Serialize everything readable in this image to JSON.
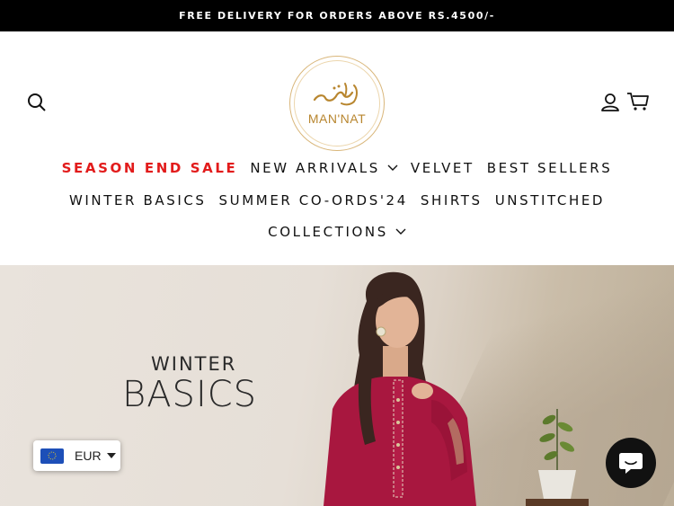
{
  "announcement": {
    "text": "FREE DELIVERY FOR ORDERS ABOVE RS.4500/-"
  },
  "header": {
    "logo_text": "MAN'NAT",
    "icons": {
      "search": "search-icon",
      "account": "user-icon",
      "cart": "cart-icon"
    }
  },
  "nav": {
    "row1": [
      {
        "label": "SEASON END SALE",
        "highlight": true
      },
      {
        "label": "NEW ARRIVALS",
        "dropdown": true
      },
      {
        "label": "VELVET"
      },
      {
        "label": "BEST SELLERS"
      }
    ],
    "row2": [
      {
        "label": "WINTER BASICS"
      },
      {
        "label": "SUMMER CO-ORDS'24"
      },
      {
        "label": "SHIRTS"
      },
      {
        "label": "UNSTITCHED"
      }
    ],
    "row3": [
      {
        "label": "COLLECTIONS",
        "dropdown": true
      }
    ]
  },
  "hero": {
    "line1": "WINTER",
    "line2": "BASICS"
  },
  "currency": {
    "code": "EUR",
    "flag": "eu-flag-icon"
  },
  "chat": {
    "icon": "chat-icon"
  },
  "colors": {
    "sale": "#e21b1b",
    "gold": "#b8862f",
    "topbar": "#000000",
    "dress": "#a8173f"
  }
}
